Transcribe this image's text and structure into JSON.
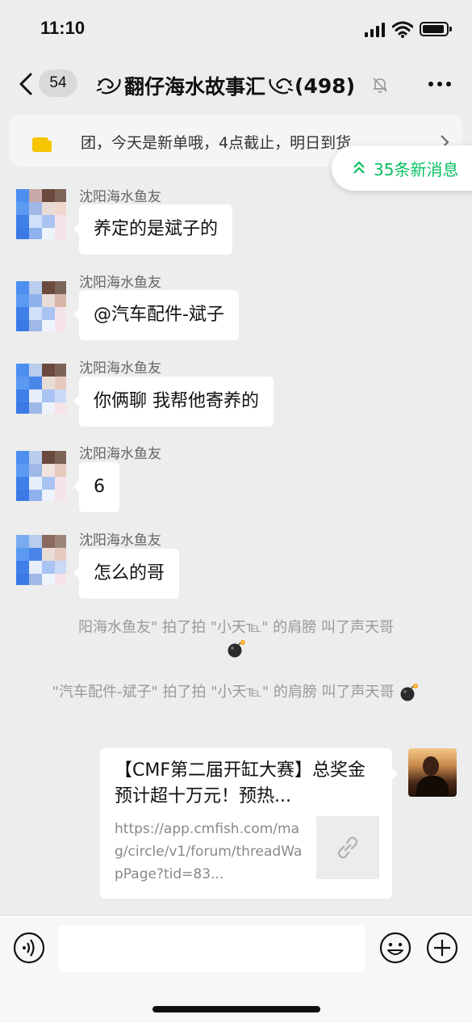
{
  "status_bar": {
    "time": "11:10"
  },
  "nav": {
    "back_count": "54",
    "title": "翻仔海水故事汇",
    "member_count": "(498)"
  },
  "notice": {
    "text": "团，今天是新单哦，4点截止，明日到货..."
  },
  "new_messages": {
    "label": "35条新消息"
  },
  "messages": [
    {
      "sender": "沈阳海水鱼友",
      "text": "养定的是斌子的"
    },
    {
      "sender": "沈阳海水鱼友",
      "text": "@汽车配件-斌子"
    },
    {
      "sender": "沈阳海水鱼友",
      "text": "你俩聊 我帮他寄养的"
    },
    {
      "sender": "沈阳海水鱼友",
      "text": "6"
    },
    {
      "sender": "沈阳海水鱼友",
      "text": "怎么的哥"
    }
  ],
  "system_messages": [
    {
      "text": "阳海水鱼友\" 拍了拍 \"小天℡\" 的肩膀 叫了声天哥"
    },
    {
      "text": "\"汽车配件-斌子\" 拍了拍 \"小天℡\" 的肩膀 叫了声天哥"
    }
  ],
  "link_card": {
    "title": "【CMF第二届开缸大赛】总奖金预计超十万元！预热...",
    "url": "https://app.cmfish.com/mag/circle/v1/forum/threadWapPage?tid=83..."
  },
  "icons": {
    "back": "chevron-left-icon",
    "mute": "bell-off-icon",
    "more": "more-icon",
    "notice": "megaphone-icon",
    "new_messages": "double-chevron-up-icon",
    "voice": "voice-icon",
    "emoji": "emoji-icon",
    "plus": "plus-icon",
    "link": "link-icon",
    "bomb": "bomb-icon"
  },
  "colors": {
    "accent": "#07c160",
    "background": "#ededed",
    "notice_icon": "#f5c400"
  }
}
